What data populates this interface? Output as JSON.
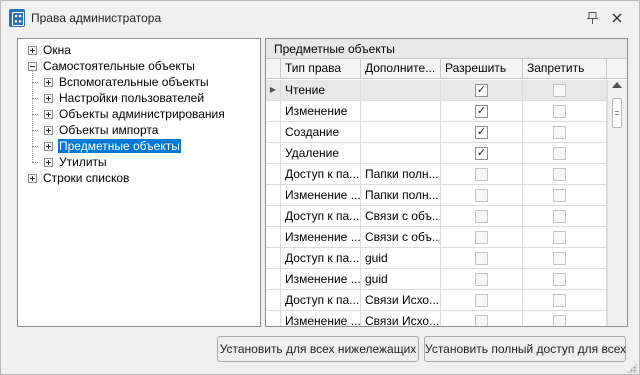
{
  "window": {
    "title": "Права администратора",
    "pin_icon": "pin-icon",
    "close_icon": "close-icon"
  },
  "tree": {
    "items": [
      {
        "label": "Окна",
        "level": 0,
        "expander": "plus"
      },
      {
        "label": "Самостоятельные объекты",
        "level": 0,
        "expander": "minus"
      },
      {
        "label": "Вспомогательные объекты",
        "level": 1,
        "expander": "plus"
      },
      {
        "label": "Настройки пользователей",
        "level": 1,
        "expander": "plus"
      },
      {
        "label": "Объекты администрирования",
        "level": 1,
        "expander": "plus"
      },
      {
        "label": "Объекты импорта",
        "level": 1,
        "expander": "plus"
      },
      {
        "label": "Предметные объекты",
        "level": 1,
        "expander": "plus",
        "selected": true
      },
      {
        "label": "Утилиты",
        "level": 1,
        "expander": "plus"
      },
      {
        "label": "Строки списков",
        "level": 0,
        "expander": "plus"
      }
    ]
  },
  "grid": {
    "caption": "Предметные объекты",
    "columns": [
      "Тип права",
      "Дополните...",
      "Разрешить",
      "Запретить"
    ],
    "rows": [
      {
        "type": "Чтение",
        "extra": "",
        "allow": true,
        "deny": false,
        "allow_enabled": true,
        "selected": true
      },
      {
        "type": "Изменение",
        "extra": "",
        "allow": true,
        "deny": false,
        "allow_enabled": true
      },
      {
        "type": "Создание",
        "extra": "",
        "allow": true,
        "deny": false,
        "allow_enabled": true
      },
      {
        "type": "Удаление",
        "extra": "",
        "allow": true,
        "deny": false,
        "allow_enabled": true
      },
      {
        "type": "Доступ к па...",
        "extra": "Папки полн...",
        "allow": false,
        "deny": false,
        "allow_enabled": true
      },
      {
        "type": "Изменение ...",
        "extra": "Папки полн...",
        "allow": false,
        "deny": false,
        "allow_enabled": true
      },
      {
        "type": "Доступ к па...",
        "extra": "Связи с объ...",
        "allow": false,
        "deny": false,
        "allow_enabled": true
      },
      {
        "type": "Изменение ...",
        "extra": "Связи с объ...",
        "allow": false,
        "deny": false,
        "allow_enabled": true
      },
      {
        "type": "Доступ к па...",
        "extra": "guid",
        "allow": false,
        "deny": false,
        "allow_enabled": true
      },
      {
        "type": "Изменение ...",
        "extra": "guid",
        "allow": false,
        "deny": false,
        "allow_enabled": true
      },
      {
        "type": "Доступ к па...",
        "extra": "Связи Исхо...",
        "allow": false,
        "deny": false,
        "allow_enabled": true
      },
      {
        "type": "Изменение ...",
        "extra": "Связи Исхо...",
        "allow": false,
        "deny": false,
        "allow_enabled": true
      }
    ],
    "check_mark": "✓"
  },
  "buttons": {
    "apply_below": "Установить для всех нижележащих",
    "full_access": "Установить полный доступ для всех"
  }
}
